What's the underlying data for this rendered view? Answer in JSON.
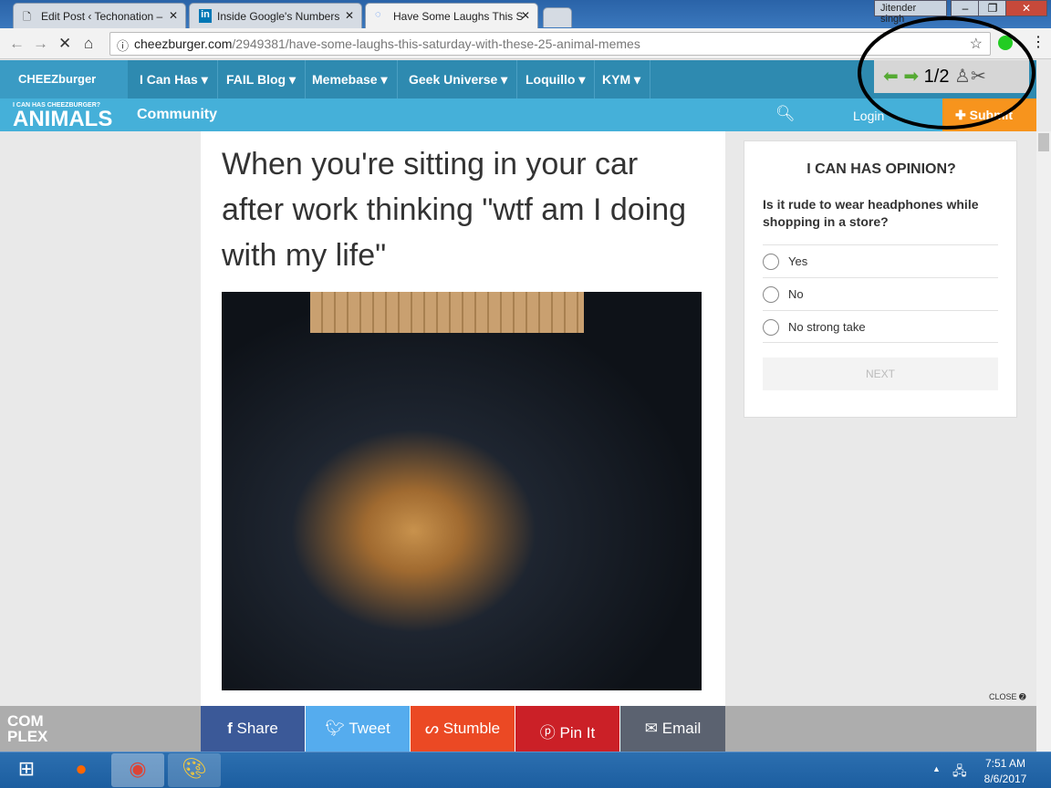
{
  "browser": {
    "tabs": [
      {
        "label": "Edit Post ‹ Techonation –",
        "icon": "document-icon"
      },
      {
        "label": "Inside Google's Numbers",
        "icon": "linkedin-icon"
      },
      {
        "label": "Have Some Laughs This S",
        "icon": "loading-spinner-icon"
      }
    ],
    "user": "Jitender singh",
    "url_domain": "cheezburger.com",
    "url_path": "/2949381/have-some-laughs-this-saturday-with-these-25-animal-memes"
  },
  "extension": {
    "counter": "1/2"
  },
  "site": {
    "logo_top": "CHEEZburger",
    "logo_sub": "I CAN HAS CHEEZBURGER?",
    "logo_main": "ANIMALS",
    "nav": [
      "I Can Has",
      "FAIL Blog",
      "Memebase",
      "Geek Universe",
      "Loquillo",
      "KYM"
    ],
    "community": "Community",
    "login": "Login",
    "submit": "Submit"
  },
  "article": {
    "title": "When you're sitting in your car after work thinking \"wtf am I doing with my life\""
  },
  "poll": {
    "heading": "I CAN HAS OPINION?",
    "question": "Is it rude to wear headphones while shopping in a store?",
    "options": [
      "Yes",
      "No",
      "No strong take"
    ],
    "next": "NEXT"
  },
  "ad": {
    "close": "CLOSE",
    "brand": "COM PLEX"
  },
  "share": [
    {
      "label": "Share",
      "icon": "facebook-icon",
      "color": "#3b5998"
    },
    {
      "label": "Tweet",
      "icon": "twitter-icon",
      "color": "#55acee"
    },
    {
      "label": "Stumble",
      "icon": "stumbleupon-icon",
      "color": "#eb4924"
    },
    {
      "label": "Pin It",
      "icon": "pinterest-icon",
      "color": "#cb2027"
    },
    {
      "label": "Email",
      "icon": "email-icon",
      "color": "#5b6270"
    }
  ],
  "taskbar": {
    "time": "7:51 AM",
    "date": "8/6/2017"
  }
}
